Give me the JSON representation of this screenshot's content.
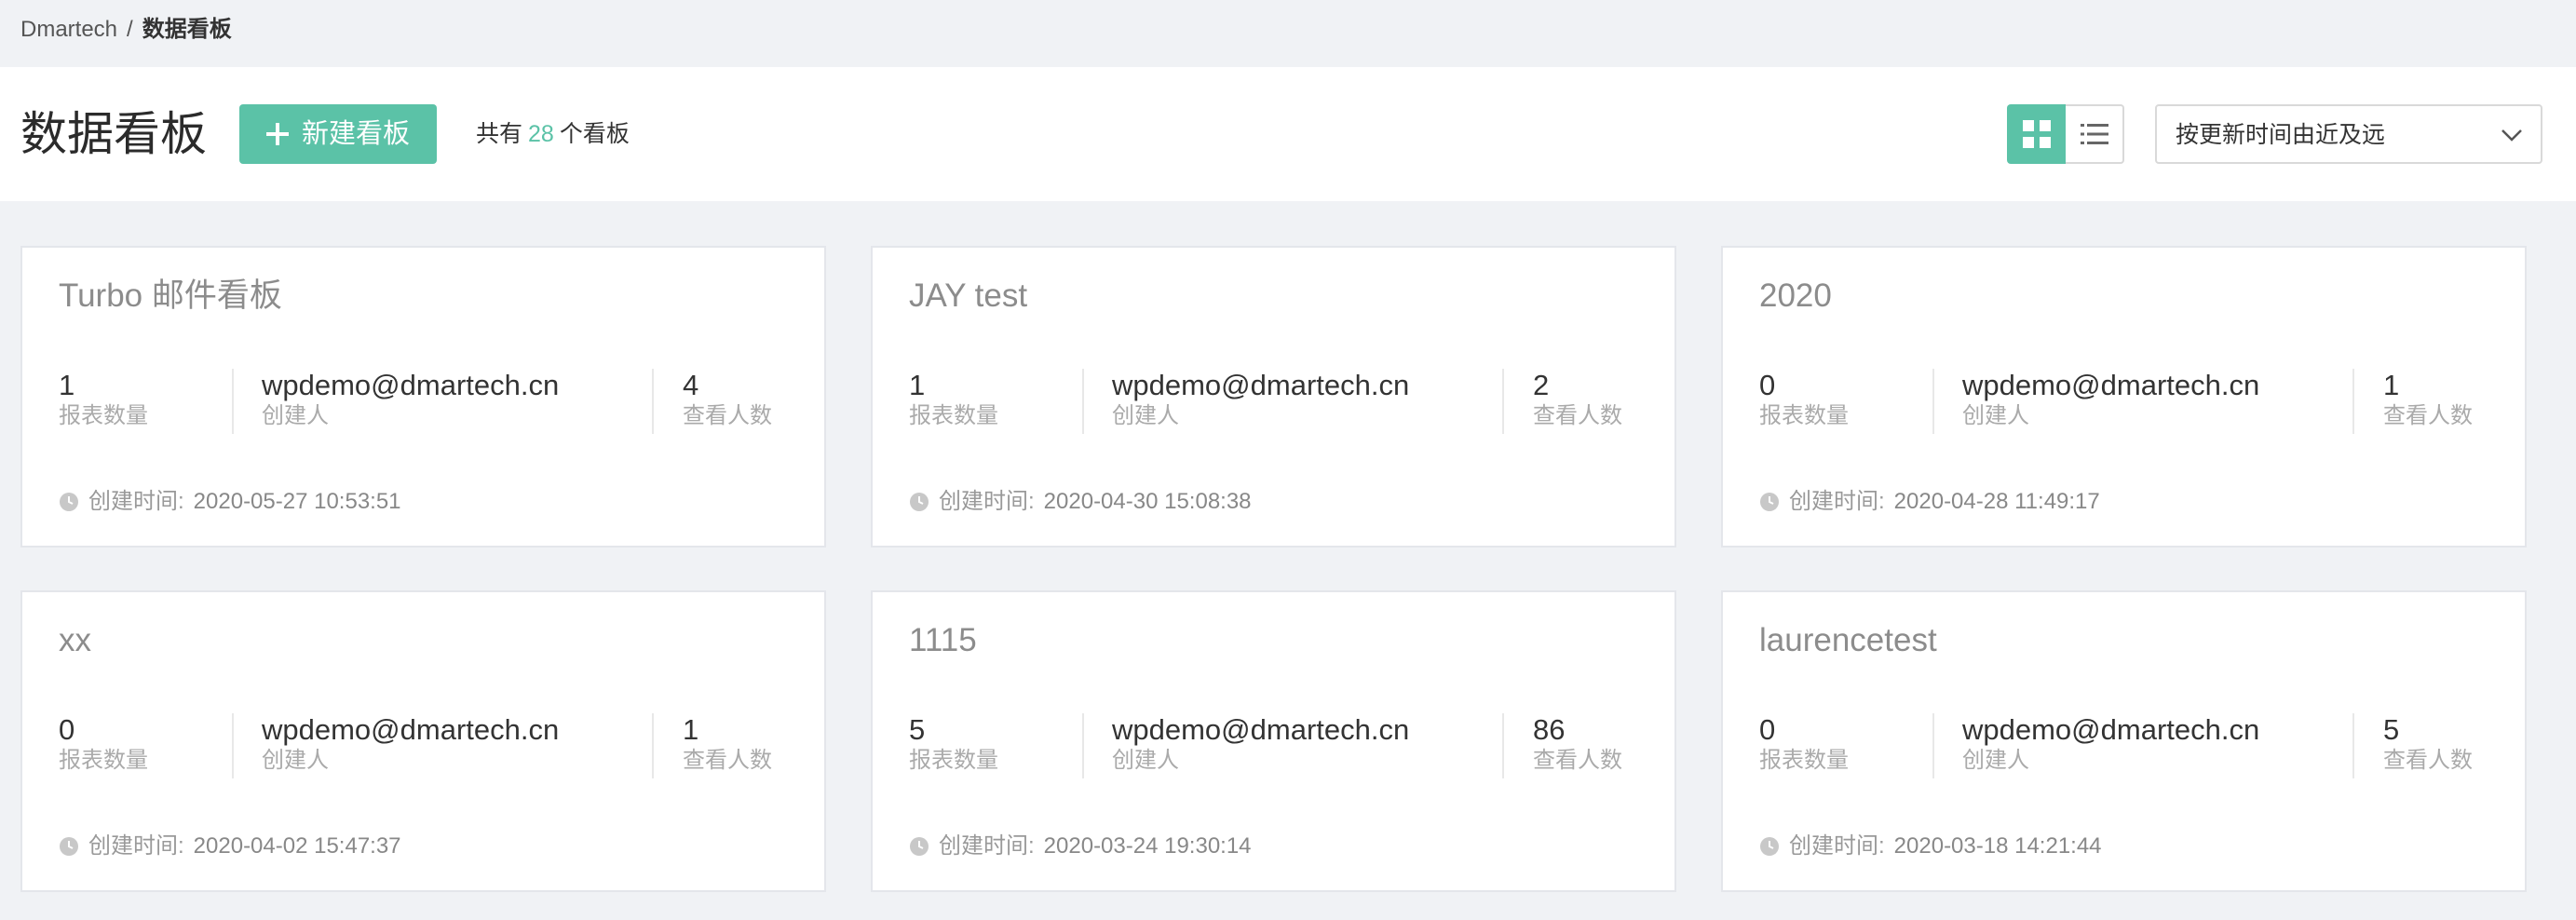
{
  "breadcrumb": {
    "root": "Dmartech",
    "separator": "/",
    "current": "数据看板"
  },
  "header": {
    "title": "数据看板",
    "new_button_label": "新建看板",
    "count_prefix": "共有",
    "count_value": "28",
    "count_suffix": "个看板",
    "sort_selected": "按更新时间由近及远"
  },
  "colors": {
    "accent": "#5bc2a7",
    "page_background": "#f0f2f5"
  },
  "icons": {
    "add": "plus-icon",
    "grid_view": "grid-icon",
    "list_view": "list-icon",
    "dropdown": "chevron-down-icon",
    "time": "clock-icon"
  },
  "labels": {
    "report_count": "报表数量",
    "creator": "创建人",
    "viewers": "查看人数",
    "created_time": "创建时间:"
  },
  "cards": [
    {
      "title": "Turbo 邮件看板",
      "report_count": "1",
      "creator": "wpdemo@dmartech.cn",
      "viewers": "4",
      "created_at": "2020-05-27 10:53:51"
    },
    {
      "title": "JAY test",
      "report_count": "1",
      "creator": "wpdemo@dmartech.cn",
      "viewers": "2",
      "created_at": "2020-04-30 15:08:38"
    },
    {
      "title": "2020",
      "report_count": "0",
      "creator": "wpdemo@dmartech.cn",
      "viewers": "1",
      "created_at": "2020-04-28 11:49:17"
    },
    {
      "title": "xx",
      "report_count": "0",
      "creator": "wpdemo@dmartech.cn",
      "viewers": "1",
      "created_at": "2020-04-02 15:47:37"
    },
    {
      "title": "1115",
      "report_count": "5",
      "creator": "wpdemo@dmartech.cn",
      "viewers": "86",
      "created_at": "2020-03-24 19:30:14"
    },
    {
      "title": "laurencetest",
      "report_count": "0",
      "creator": "wpdemo@dmartech.cn",
      "viewers": "5",
      "created_at": "2020-03-18 14:21:44"
    }
  ]
}
